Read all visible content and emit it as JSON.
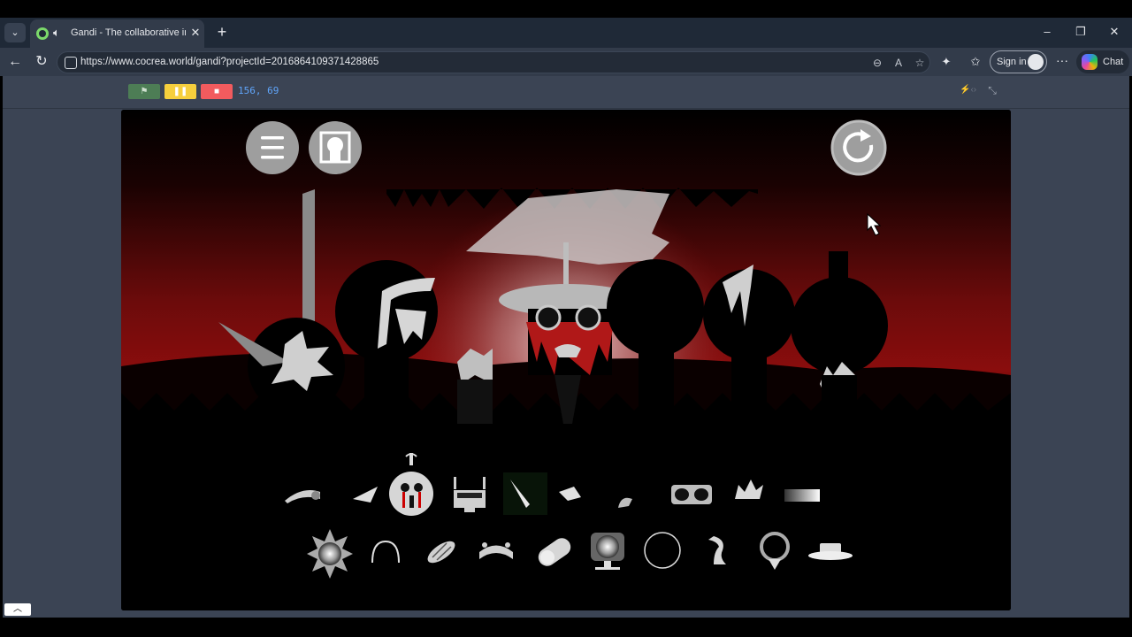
{
  "browser": {
    "tab": {
      "title": "Gandi - The collaborative in-b",
      "audio_icon": "speaker-icon",
      "close_label": "✕"
    },
    "new_tab_label": "+",
    "window_controls": {
      "minimize": "–",
      "maximize": "❐",
      "close": "✕"
    },
    "url": "https://www.cocrea.world/gandi?projectId=2016864109371428865",
    "signin_label": "Sign in",
    "chat_label": "Chat",
    "more_label": "···"
  },
  "player": {
    "flag_label": "⚑",
    "pause_label": "❚❚",
    "stop_label": "■",
    "coordinates": "156, 69",
    "fullscreen_label": "⤡",
    "collapse_label": "︿"
  },
  "stage": {
    "menu_button_icon": "hamburger-icon",
    "profile_button_icon": "avatar-frame-icon",
    "reset_button_icon": "refresh-icon",
    "colors": {
      "sky_red": "#8a0d0d",
      "ground": "#000000",
      "button_grey": "#9e9e9e"
    },
    "sound_icons_row1": [
      "swipe",
      "blade",
      "screaming-face",
      "robot-head",
      "beam",
      "shard",
      "hook",
      "double-orb",
      "crown",
      "gradient-bar"
    ],
    "sound_icons_row2": [
      "sun-burst",
      "arch",
      "striped-bean",
      "horned-band",
      "capsule",
      "glowing-monitor",
      "ring",
      "curl",
      "award-ring",
      "hat"
    ]
  }
}
